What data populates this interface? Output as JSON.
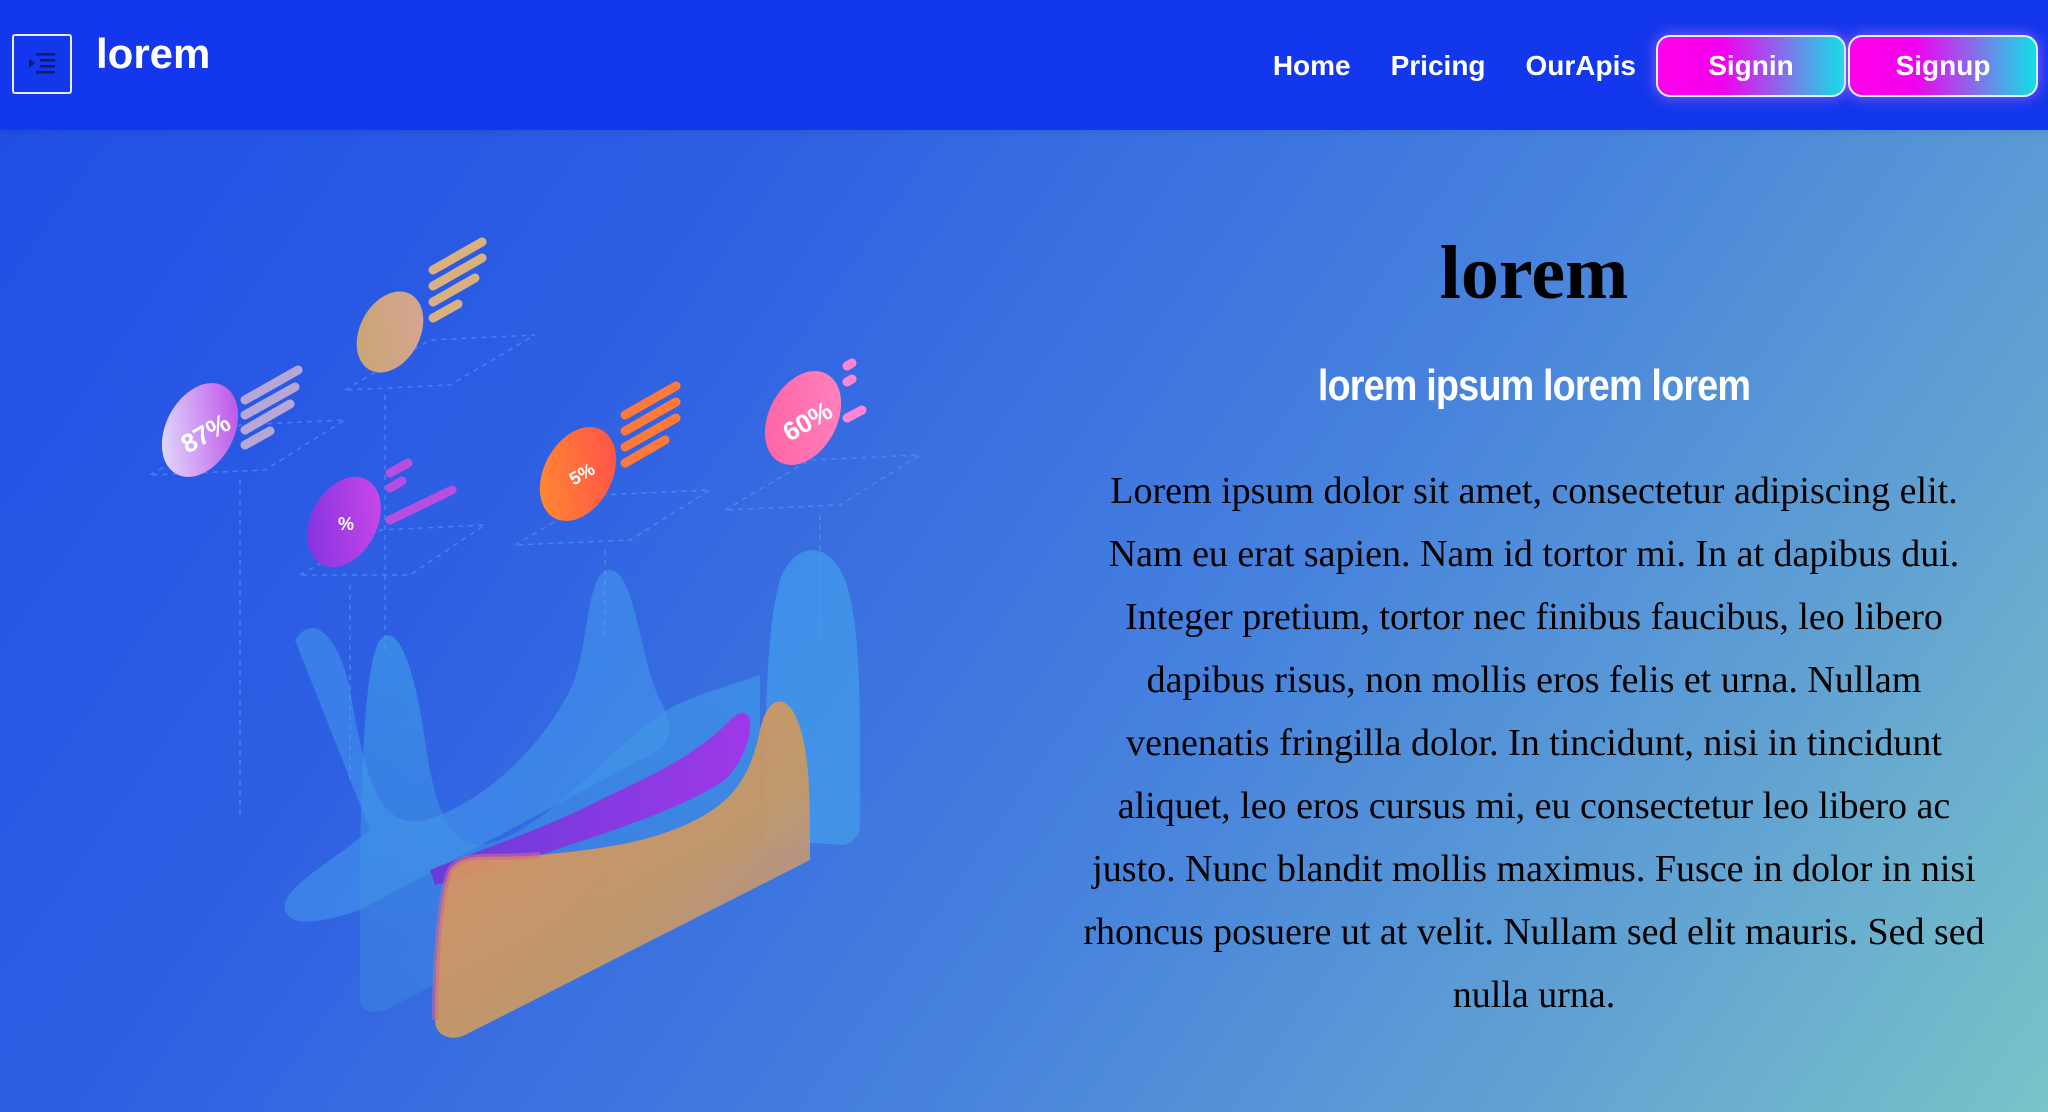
{
  "navbar": {
    "menu_icon": "menu-indent-icon",
    "brand": "lorem",
    "links": [
      "Home",
      "Pricing",
      "OurApis"
    ],
    "signin_label": "Signin",
    "signup_label": "Signup",
    "background_color": "#1337ec",
    "button_gradient": [
      "#ff00ea",
      "#12e0e6"
    ]
  },
  "hero": {
    "title": "lorem",
    "subtitle": "lorem ipsum lorem lorem",
    "body": "Lorem ipsum dolor sit amet, consectetur adipiscing elit. Nam eu erat sapien. Nam id tortor mi. In at dapibus dui. Integer pretium, tortor nec finibus faucibus, leo libero dapibus risus, non mollis eros felis et urna. Nullam venenatis fringilla dolor. In tincidunt, nisi in tincidunt aliquet, leo eros cursus mi, eu consectetur leo libero ac justo. Nunc blandit mollis maximus. Fusce in dolor in nisi rhoncus posuere ut at velit. Nullam sed elit mauris. Sed sed nulla urna."
  },
  "illustration": {
    "badges": [
      "87%",
      "%",
      "5%",
      "60%"
    ]
  }
}
